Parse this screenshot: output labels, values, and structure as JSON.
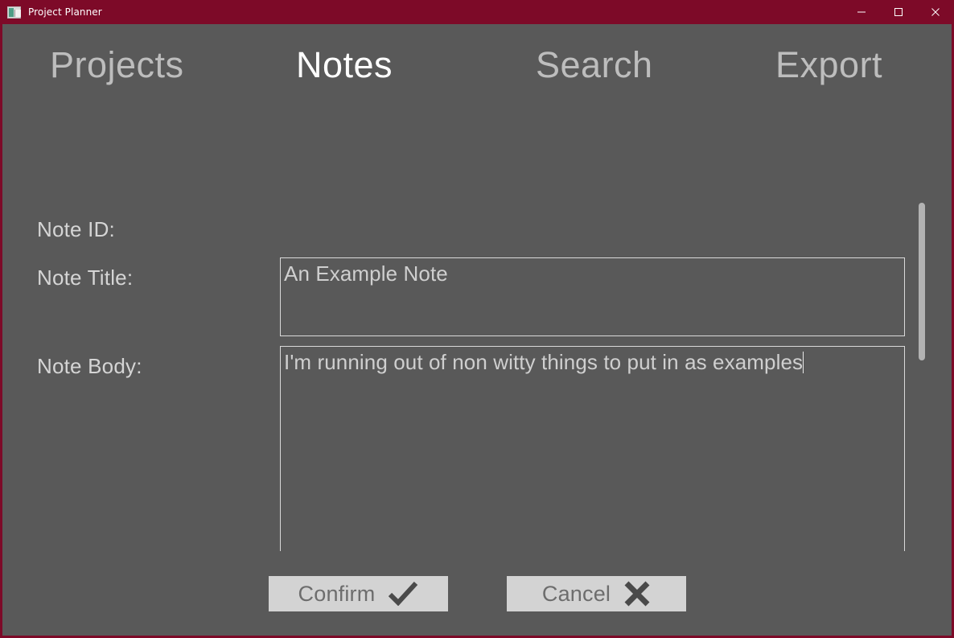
{
  "window": {
    "title": "Project Planner",
    "icon": "app-window-icon",
    "titlebar_color": "#7d0a28",
    "body_color": "#595959",
    "controls": {
      "minimize": "minimize-icon",
      "maximize": "maximize-icon",
      "close": "close-icon"
    }
  },
  "nav": {
    "tabs": [
      {
        "label": "Projects",
        "active": false
      },
      {
        "label": "Notes",
        "active": true
      },
      {
        "label": "Search",
        "active": false
      },
      {
        "label": "Export",
        "active": false
      }
    ],
    "active_color": "#ffffff",
    "inactive_color": "#bdbdbd"
  },
  "form": {
    "fields": [
      {
        "label": "Note ID:",
        "value": "",
        "placeholder": ""
      },
      {
        "label": "Note Title:",
        "value": "An Example Note",
        "placeholder": ""
      },
      {
        "label": "Note Body:",
        "value": "I'm running out of non witty things to put in as examples",
        "placeholder": ""
      }
    ]
  },
  "scrollbar": {
    "orientation": "vertical",
    "thumb_color": "#b3b3b3"
  },
  "buttons": {
    "confirm": {
      "label": "Confirm",
      "icon": "check-icon",
      "bg": "#d3d3d3",
      "text_color": "#6d6d6d"
    },
    "cancel": {
      "label": "Cancel",
      "icon": "cross-icon",
      "bg": "#d3d3d3",
      "text_color": "#6d6d6d"
    }
  }
}
